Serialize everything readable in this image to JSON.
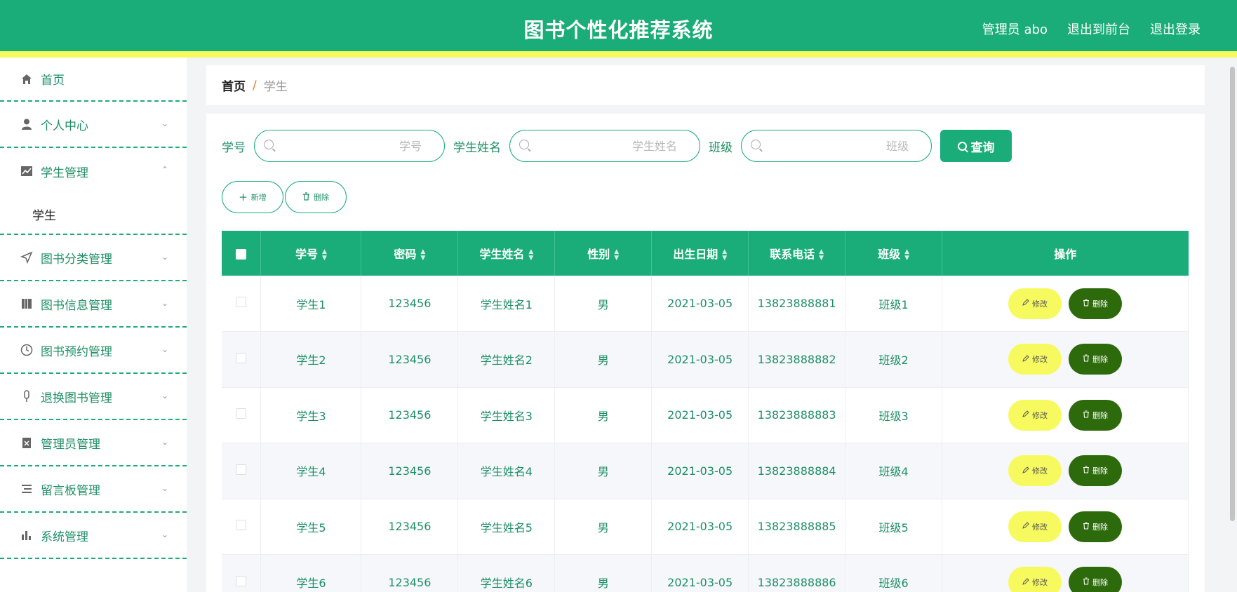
{
  "header": {
    "title": "图书个性化推荐系统",
    "user_label": "管理员 abo",
    "front_label": "退出到前台",
    "logout_label": "退出登录"
  },
  "sidebar": {
    "items": [
      {
        "label": "首页",
        "icon": "home-icon"
      },
      {
        "label": "个人中心",
        "icon": "user-icon"
      },
      {
        "label": "学生管理",
        "icon": "chart-icon",
        "sub": "学生"
      },
      {
        "label": "图书分类管理",
        "icon": "navigation-icon"
      },
      {
        "label": "图书信息管理",
        "icon": "book-icon"
      },
      {
        "label": "图书预约管理",
        "icon": "clock-icon"
      },
      {
        "label": "退换图书管理",
        "icon": "microphone-icon"
      },
      {
        "label": "管理员管理",
        "icon": "clipboard-icon"
      },
      {
        "label": "留言板管理",
        "icon": "list-icon"
      },
      {
        "label": "系统管理",
        "icon": "bar-chart-icon"
      }
    ]
  },
  "breadcrumb": {
    "home": "首页",
    "separator": "/",
    "current": "学生"
  },
  "search": {
    "student_no_label": "学号",
    "student_no_placeholder": "学号",
    "student_name_label": "学生姓名",
    "student_name_placeholder": "学生姓名",
    "class_label": "班级",
    "class_placeholder": "班级",
    "query_label": "查询"
  },
  "actions": {
    "add_label": "新增",
    "delete_label": "删除"
  },
  "table": {
    "headers": [
      "学号",
      "密码",
      "学生姓名",
      "性别",
      "出生日期",
      "联系电话",
      "班级",
      "操作"
    ],
    "edit_label": "修改",
    "delete_label": "删除",
    "rows": [
      [
        "学生1",
        "123456",
        "学生姓名1",
        "男",
        "2021-03-05",
        "13823888881",
        "班级1"
      ],
      [
        "学生2",
        "123456",
        "学生姓名2",
        "男",
        "2021-03-05",
        "13823888882",
        "班级2"
      ],
      [
        "学生3",
        "123456",
        "学生姓名3",
        "男",
        "2021-03-05",
        "13823888883",
        "班级3"
      ],
      [
        "学生4",
        "123456",
        "学生姓名4",
        "男",
        "2021-03-05",
        "13823888884",
        "班级4"
      ],
      [
        "学生5",
        "123456",
        "学生姓名5",
        "男",
        "2021-03-05",
        "13823888885",
        "班级5"
      ],
      [
        "学生6",
        "123456",
        "学生姓名6",
        "男",
        "2021-03-05",
        "13823888886",
        "班级6"
      ]
    ]
  },
  "colors": {
    "primary": "#1aad7a",
    "accent_yellow": "#f7fa5e",
    "delete_dark_green": "#2d6a0c"
  }
}
